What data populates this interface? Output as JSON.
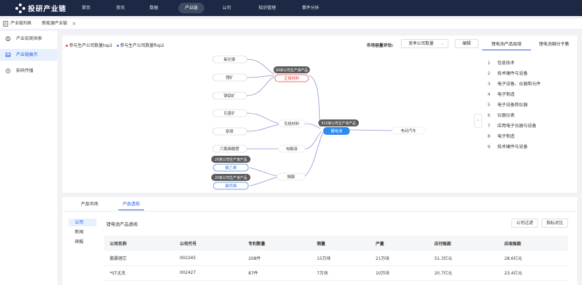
{
  "app": {
    "title": "投研产业链"
  },
  "nav": [
    "首页",
    "资讯",
    "数据",
    "产业链",
    "公司",
    "知识管理",
    "事件分析"
  ],
  "tabs": [
    {
      "label": "产业链列表"
    },
    {
      "label": "新能源产业链"
    }
  ],
  "sidebar": {
    "items": [
      {
        "label": "产业宏观探索",
        "icon": "globe-icon"
      },
      {
        "label": "产业链展示",
        "icon": "image-icon"
      },
      {
        "label": "影响传播",
        "icon": "broadcast-icon"
      }
    ]
  },
  "graph": {
    "legend": [
      {
        "label": "参与生产公司数量top2",
        "color": "#e0403a"
      },
      {
        "label": "参与生产公司数量flop2",
        "color": "#3b7ddd"
      }
    ],
    "evaluate_label": "市场容量评估:",
    "select_value": "竞争公司数量",
    "edit_button": "编辑",
    "nodes": {
      "n1": "氧化镍",
      "n2": "锂矿",
      "n3": "钢铝矿",
      "c1": "30家公司生产该产品",
      "p1": "正极材料",
      "n4": "石墨矿",
      "n5": "原煤",
      "mid1": "负极材料",
      "n6": "六氟磷酸锂",
      "mid2": "电解液",
      "c2": "20家公司生产该产品",
      "p2": "聚乙烯",
      "c3": "20家公司生产该产品",
      "p3": "聚丙烯",
      "mid3": "隔膜",
      "c4": "520家公司生产该产品",
      "center": "锂电池",
      "target": "电动汽车"
    }
  },
  "right_panel": {
    "tabs": [
      "锂电池产品层级",
      "锂电池细分子集"
    ],
    "items": [
      "信息技术",
      "技术硬件与设备",
      "电子设备、仪器和元件",
      "电子制造",
      "电子设备和仪器",
      "仪器仪表",
      "应用电子仪器与设备",
      "电子制造",
      "技术硬件与设备"
    ]
  },
  "bottom": {
    "tabs": [
      "产品市场",
      "产品透视"
    ],
    "subnav": [
      "公司",
      "新闻",
      "研报"
    ],
    "section_title": "锂电池产品透视",
    "buttons": {
      "filter": "公司过滤",
      "compare": "指标对比"
    },
    "columns": [
      "公司名称",
      "公司代号",
      "专利数量",
      "销量",
      "产量",
      "应付账款",
      "应收账款"
    ],
    "rows": [
      [
        "鹏晨锂芯",
        "002245",
        "208件",
        "15万块",
        "21万块",
        "51.3亿元",
        "28.6亿元"
      ],
      [
        "*ST尤夫",
        "002427",
        "87件",
        "7万块",
        "10万块",
        "20.7亿元",
        "23.4亿元"
      ]
    ]
  },
  "colors": {
    "nav_bg": "#1d2844",
    "accent": "#1e5ce4",
    "dark_badge": "#555",
    "red": "#e0403a",
    "blue": "#3b7ddd",
    "edge": "#8e8fd6"
  }
}
